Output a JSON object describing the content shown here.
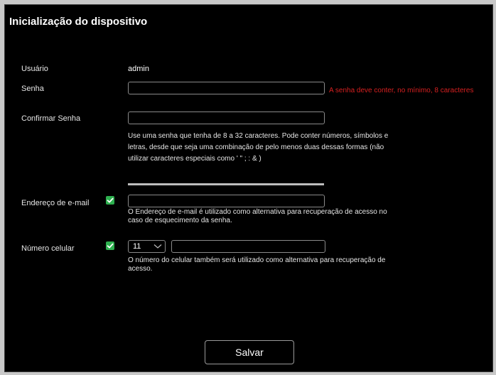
{
  "page": {
    "title": "Inicialização do dispositivo"
  },
  "form": {
    "user": {
      "label": "Usuário",
      "value": "admin"
    },
    "password": {
      "label": "Senha",
      "value": "",
      "error": "A senha deve conter, no mínimo, 8 caracteres"
    },
    "confirm_password": {
      "label": "Confirmar Senha",
      "value": "",
      "hint_line1": "Use uma senha que tenha de 8 a 32 caracteres. Pode conter números, símbolos e",
      "hint_line2": "letras, desde que seja uma combinação de pelo menos duas dessas formas (não",
      "hint_line3": "utilizar caracteres especiais como ' \" ; : & )"
    },
    "email": {
      "label": "Endereço de e-mail",
      "checked": true,
      "value": "",
      "note_line1": "O Endereço de e-mail é utilizado como alternativa para recuperação de acesso no",
      "note_line2": "caso de esquecimento da senha."
    },
    "phone": {
      "label": "Número celular",
      "checked": true,
      "country_code": "11",
      "value": "",
      "note_line1": "O número do celular também será utilizado como alternativa para recuperação de",
      "note_line2": "acesso."
    }
  },
  "actions": {
    "save_label": "Salvar"
  },
  "colors": {
    "background": "#000000",
    "error": "#d62020",
    "checkbox": "#2eb04f"
  }
}
